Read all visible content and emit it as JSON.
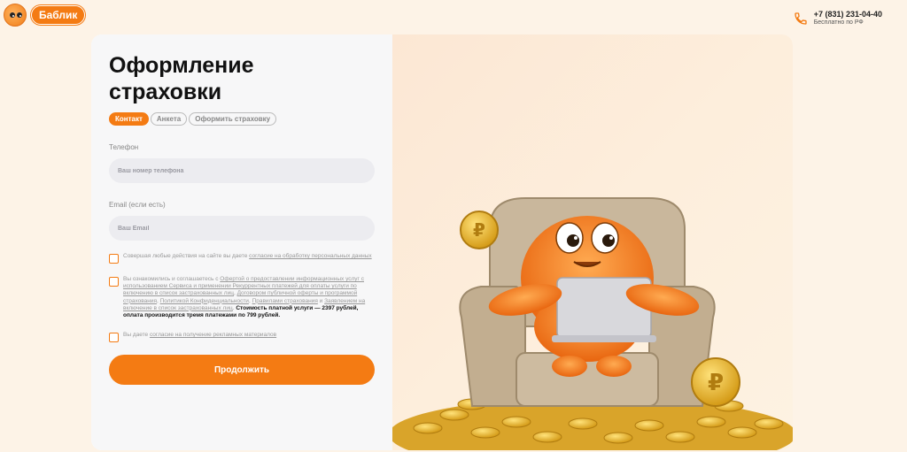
{
  "header": {
    "brand": "Баблик",
    "phone": "+7 (831) 231-04-40",
    "phone_note": "Бесплатно по РФ"
  },
  "form": {
    "title": "Оформление страховки",
    "tabs": [
      {
        "label": "Контакт",
        "active": true
      },
      {
        "label": "Анкета",
        "active": false
      },
      {
        "label": "Оформить страховку",
        "active": false
      }
    ],
    "phone_label": "Телефон",
    "phone_placeholder": "Ваш номер телефона",
    "email_label": "Email (если есть)",
    "email_placeholder": "Ваш Email",
    "consent1": {
      "text": "Совершая любые действия на сайте вы даете ",
      "link": "согласие на обработку персональных данных"
    },
    "consent2": {
      "t1": "Вы ознакомились и соглашаетесь с ",
      "l1": "Офертой о предоставлении информационных услуг с использованием Сервиса и применении Рекуррентных платежей для оплаты услуги по включению в список застрахованных лиц",
      "t2": ", ",
      "l2": "Договором публичной оферты и программой страхования",
      "t3": ", ",
      "l3": "Политикой Конфиденциальности",
      "t4": ", ",
      "l4": "Правилами страхования",
      "t5": " и ",
      "l5": "Заявлением на включение в список застрахованных лиц",
      "t6": ". ",
      "bold": "Стоимость платной услуги — 2397 рублей, оплата производится тремя платежами по 799 рублей."
    },
    "consent3": {
      "text": "Вы даете ",
      "link": "согласие на получение рекламных материалов"
    },
    "submit": "Продолжить"
  },
  "colors": {
    "accent": "#f47b13",
    "background": "#fdf3e7"
  },
  "icons": {
    "phone": "phone-icon",
    "mascot": "mascot-logo"
  }
}
